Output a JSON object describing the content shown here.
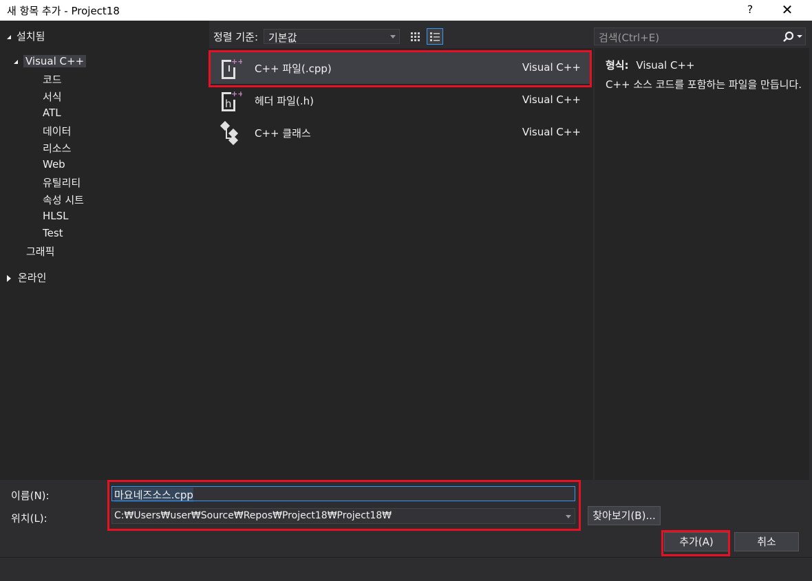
{
  "window": {
    "title": "새 항목 추가 - Project18",
    "help_label": "?",
    "close_label": "✕"
  },
  "tree": {
    "installed_label": "설치됨",
    "visual_cpp_label": "Visual C++",
    "children": [
      "코드",
      "서식",
      "ATL",
      "데이터",
      "리소스",
      "Web",
      "유틸리티",
      "속성 시트",
      "HLSL",
      "Test"
    ],
    "graphics_label": "그래픽",
    "online_label": "온라인"
  },
  "toolbar": {
    "sort_label": "정렬 기준:",
    "sort_value": "기본값"
  },
  "search": {
    "placeholder": "검색(Ctrl+E)"
  },
  "items": [
    {
      "name": "C++ 파일(.cpp)",
      "type": "Visual C++",
      "icon": "cpp-file-icon"
    },
    {
      "name": "헤더 파일(.h)",
      "type": "Visual C++",
      "icon": "header-file-icon"
    },
    {
      "name": "C++ 클래스",
      "type": "Visual C++",
      "icon": "cpp-class-icon"
    }
  ],
  "details": {
    "type_label": "형식:",
    "type_value": "Visual C++",
    "description": "C++ 소스 코드를 포함하는 파일을 만듭니다."
  },
  "form": {
    "name_label": "이름(N):",
    "name_value": "마요네즈소스.cpp",
    "location_label": "위치(L):",
    "location_value": "C:₩Users₩user₩Source₩Repos₩Project18₩Project18₩",
    "browse_label": "찾아보기(B)..."
  },
  "buttons": {
    "add_label": "추가(A)",
    "cancel_label": "취소"
  },
  "colors": {
    "highlight": "#e81123",
    "accent": "#3399ff",
    "icon_plus": "#c586c0"
  }
}
